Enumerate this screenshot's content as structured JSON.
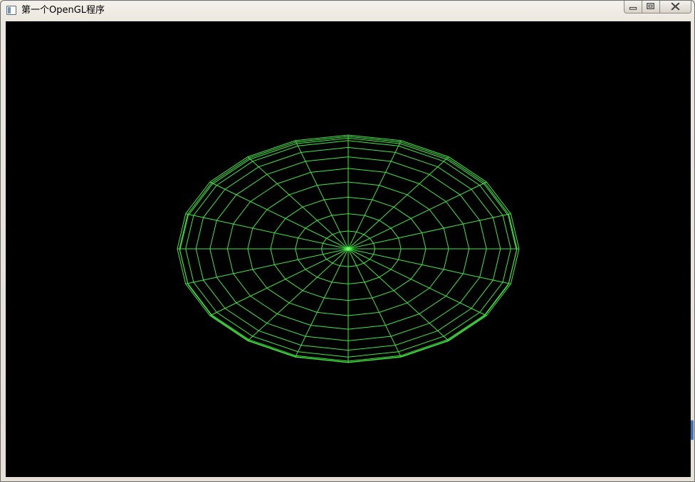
{
  "window": {
    "title": "第一个OpenGL程序",
    "icon": "app-window-icon",
    "caption_buttons": [
      {
        "name": "minimize",
        "icon": "minimize-icon"
      },
      {
        "name": "maximize",
        "icon": "maximize-icon"
      },
      {
        "name": "close",
        "icon": "close-icon"
      }
    ]
  },
  "scene": {
    "background": "#000000",
    "wire_color": "#3fe83f",
    "center_color": "#7dff7d",
    "shape": "wireframe sphere viewed from pole",
    "slices": 20,
    "stacks": 10
  }
}
